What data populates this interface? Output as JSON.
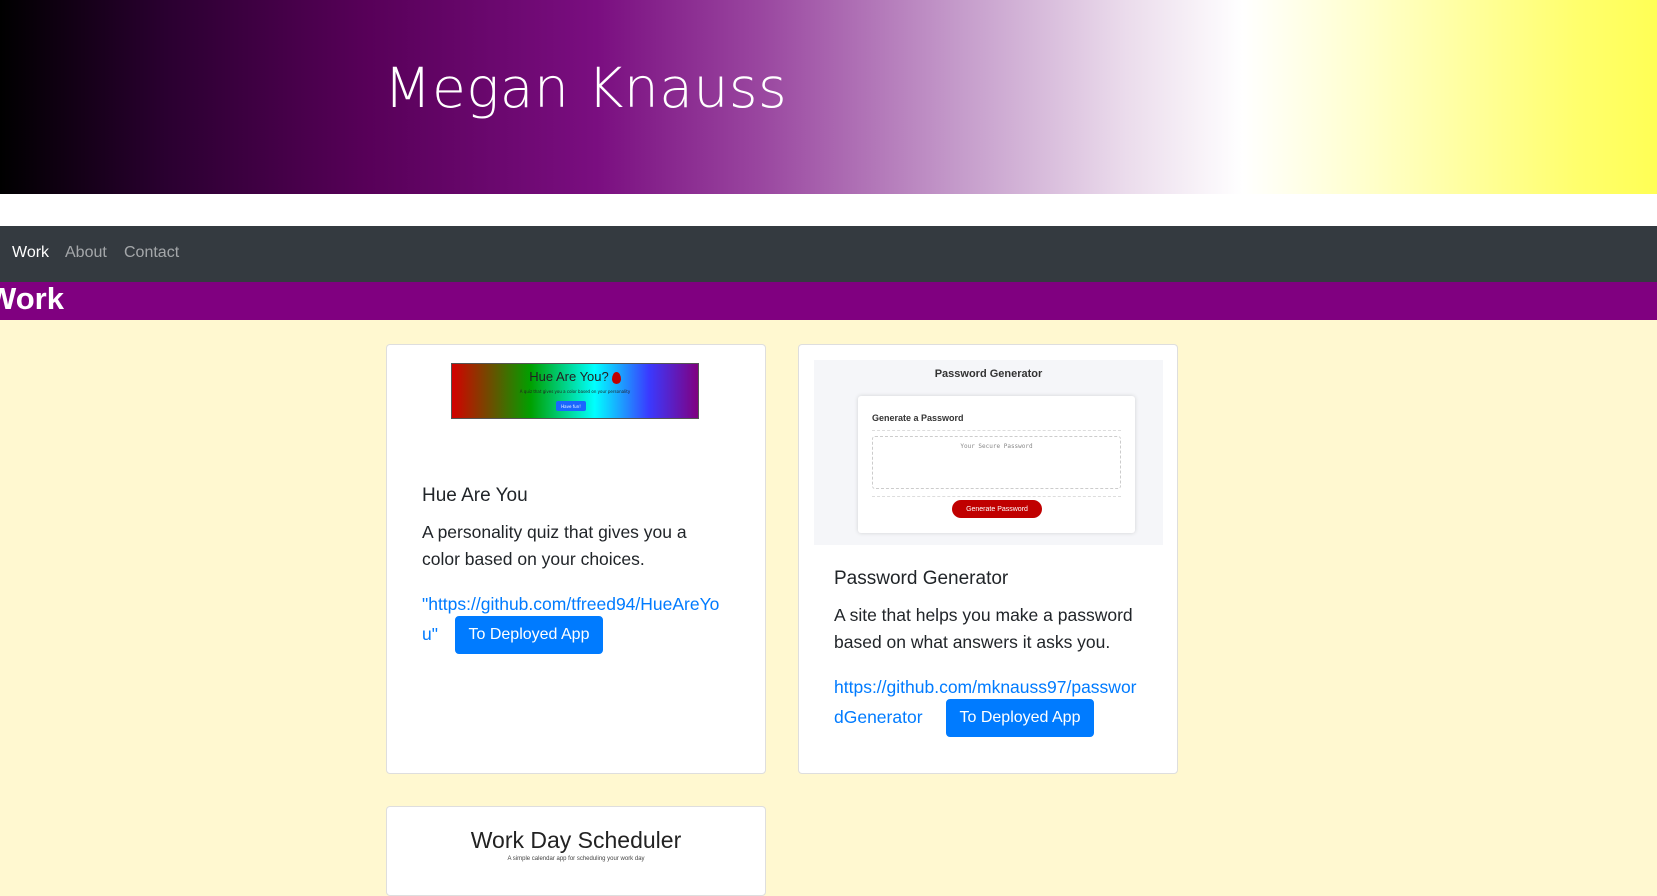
{
  "header": {
    "name": "Megan Knauss"
  },
  "nav": {
    "items": [
      {
        "label": "Work",
        "active": true
      },
      {
        "label": "About",
        "active": false
      },
      {
        "label": "Contact",
        "active": false
      }
    ]
  },
  "section": {
    "title": "Work"
  },
  "projects": [
    {
      "title": "Hue Are You",
      "description": "A personality quiz that gives you a color based on your choices.",
      "link": "\"https://github.com/tfreed94/HueAreYou\"",
      "button": "To Deployed App",
      "thumbnail": {
        "title": "Hue Are You?",
        "subtitle": "A quiz that gives you a color based on your personality",
        "button": "Have fun!"
      }
    },
    {
      "title": "Password Generator",
      "description": "A site that helps you make a password based on what answers it asks you.",
      "link": "https://github.com/mknauss97/passwordGenerator",
      "button": "To Deployed App",
      "thumbnail": {
        "heading": "Password Generator",
        "card_title": "Generate a Password",
        "placeholder": "Your Secure Password",
        "button": "Generate Password"
      }
    },
    {
      "thumbnail": {
        "title": "Work Day Scheduler",
        "subtitle": "A simple calendar app for scheduling your work day"
      }
    }
  ],
  "colors": {
    "navbar": "#343a40",
    "section_bar": "#800080",
    "page_background": "#fff8d0",
    "button": "#007bff",
    "link": "#007bff"
  }
}
